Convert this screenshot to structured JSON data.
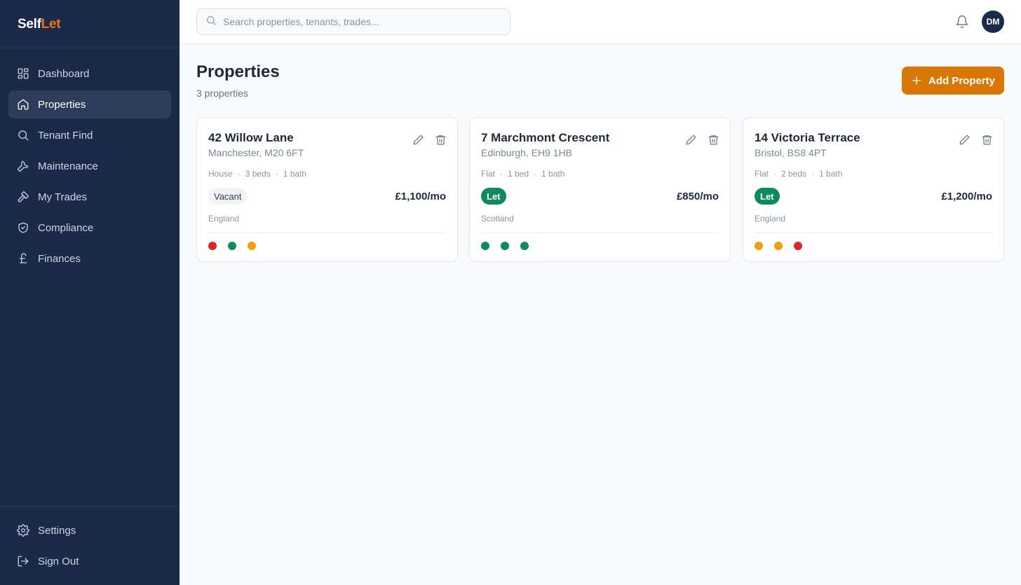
{
  "brand": {
    "part1": "Self",
    "part2": "Let"
  },
  "sidebar": {
    "items": [
      {
        "label": "Dashboard",
        "icon": "dashboard-icon"
      },
      {
        "label": "Properties",
        "icon": "home-icon",
        "active": true
      },
      {
        "label": "Tenant Find",
        "icon": "search-icon"
      },
      {
        "label": "Maintenance",
        "icon": "wrench-icon"
      },
      {
        "label": "My Trades",
        "icon": "hammer-icon"
      },
      {
        "label": "Compliance",
        "icon": "shield-check-icon"
      },
      {
        "label": "Finances",
        "icon": "pound-icon"
      }
    ],
    "bottom": [
      {
        "label": "Settings",
        "icon": "gear-icon"
      },
      {
        "label": "Sign Out",
        "icon": "sign-out-icon"
      }
    ]
  },
  "header": {
    "search_placeholder": "Search properties, tenants, trades...",
    "avatar_initials": "DM"
  },
  "main": {
    "title": "Properties",
    "subtitle": "3 properties",
    "add_button": "Add Property"
  },
  "properties": [
    {
      "name": "42 Willow Lane",
      "address": "Manchester, M20 6FT",
      "type": "House",
      "beds": "3 beds",
      "baths": "1 bath",
      "status": "Vacant",
      "rent": "£1,100/mo",
      "region": "England",
      "indicators": [
        "#dc2626",
        "#0e8a60",
        "#f59e0b"
      ]
    },
    {
      "name": "7 Marchmont Crescent",
      "address": "Edinburgh, EH9 1HB",
      "type": "Flat",
      "beds": "1 bed",
      "baths": "1 bath",
      "status": "Let",
      "rent": "£850/mo",
      "region": "Scotland",
      "indicators": [
        "#0e8a60",
        "#0e8a60",
        "#0e8a60"
      ]
    },
    {
      "name": "14 Victoria Terrace",
      "address": "Bristol, BS8 4PT",
      "type": "Flat",
      "beds": "2 beds",
      "baths": "1 bath",
      "status": "Let",
      "rent": "£1,200/mo",
      "region": "England",
      "indicators": [
        "#f59e0b",
        "#f59e0b",
        "#dc2626"
      ]
    }
  ],
  "colors": {
    "sidebar_bg": "#1c2a4a",
    "accent": "#d97706",
    "let_green": "#0e8a60"
  }
}
